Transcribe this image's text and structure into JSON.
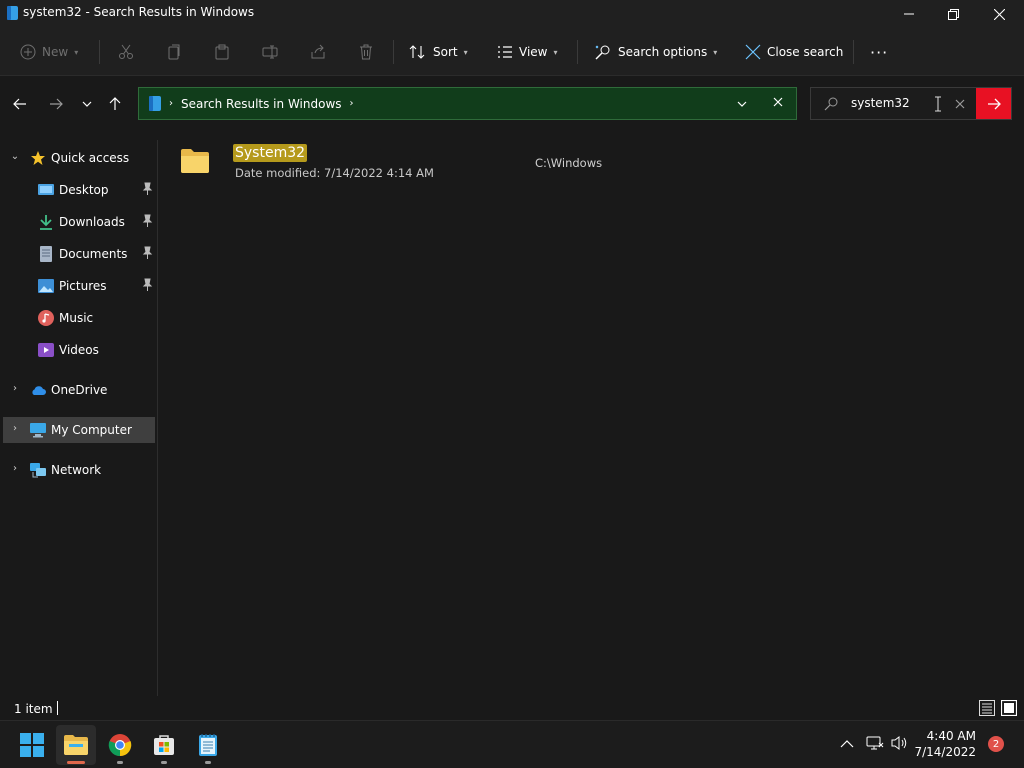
{
  "window": {
    "title": "system32 - Search Results in Windows",
    "app_icon": "explorer-icon",
    "controls": [
      "minimize-icon",
      "restore-icon",
      "close-icon"
    ]
  },
  "commandbar": {
    "new_label": "New",
    "sort_label": "Sort",
    "view_label": "View",
    "search_options_label": "Search options",
    "close_search_label": "Close search",
    "more_label": "···",
    "disabled_icons": [
      "cut-icon",
      "copy-icon",
      "paste-icon",
      "rename-icon",
      "share-icon",
      "delete-icon"
    ]
  },
  "address": {
    "breadcrumb": "Search Results in Windows"
  },
  "search": {
    "value": "system32",
    "go_icon": "arrow-right-icon"
  },
  "sidebar": {
    "quick_access": "Quick access",
    "items": [
      {
        "label": "Desktop",
        "icon": "desktop-icon",
        "pinned": true
      },
      {
        "label": "Downloads",
        "icon": "downloads-icon",
        "pinned": true
      },
      {
        "label": "Documents",
        "icon": "documents-icon",
        "pinned": true
      },
      {
        "label": "Pictures",
        "icon": "pictures-icon",
        "pinned": true
      },
      {
        "label": "Music",
        "icon": "music-icon",
        "pinned": false
      },
      {
        "label": "Videos",
        "icon": "videos-icon",
        "pinned": false
      }
    ],
    "onedrive": "OneDrive",
    "my_computer": "My Computer",
    "network": "Network"
  },
  "results": [
    {
      "name": "System32",
      "date_modified": "Date modified: 7/14/2022 4:14 AM",
      "location": "C:\\Windows"
    }
  ],
  "statusbar": {
    "item_count": "1 item"
  },
  "taskbar": {
    "apps": [
      "start-icon",
      "file-explorer-icon",
      "chrome-icon",
      "store-icon",
      "notepad-icon"
    ],
    "time": "4:40 AM",
    "date": "7/14/2022",
    "notifications": "2"
  },
  "colors": {
    "address_bg": "#113d1b",
    "highlight": "#b59a1c",
    "search_go": "#e81123"
  }
}
